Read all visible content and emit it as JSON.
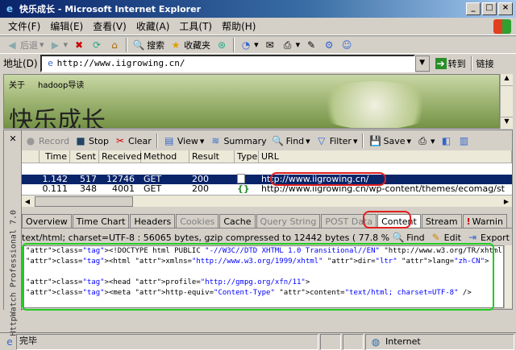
{
  "window": {
    "title": "快乐成长 - Microsoft Internet Explorer"
  },
  "menu": [
    "文件(F)",
    "编辑(E)",
    "查看(V)",
    "收藏(A)",
    "工具(T)",
    "帮助(H)"
  ],
  "toolbar": {
    "back": "后退",
    "search": "搜索",
    "favorites": "收藏夹"
  },
  "address": {
    "label": "地址(D)",
    "url": "http://www.iigrowing.cn/",
    "go": "转到",
    "links": "链接"
  },
  "page": {
    "nav": [
      "关于",
      "hadoop导读"
    ],
    "heading": "快乐成长"
  },
  "httpwatch": {
    "side_label": "HttpWatch Professional 7.0",
    "toolbar": {
      "record": "Record",
      "stop": "Stop",
      "clear": "Clear",
      "view": "View",
      "summary": "Summary",
      "find": "Find",
      "filter": "Filter",
      "save": "Save"
    },
    "columns": [
      "",
      "Time",
      "Sent",
      "Received",
      "Method",
      "Result",
      "Type",
      "URL"
    ],
    "rows": [
      {
        "time": "1.142",
        "sent": "517",
        "received": "12746",
        "method": "GET",
        "result": "200",
        "type": "page",
        "url": "http://www.iigrowing.cn/",
        "selected": true
      },
      {
        "time": "0.111",
        "sent": "348",
        "received": "4001",
        "method": "GET",
        "result": "200",
        "type": "{}",
        "url": "http://www.iigrowing.cn/wp-content/themes/ecomag/st",
        "selected": false
      }
    ],
    "tabs": [
      "Overview",
      "Time Chart",
      "Headers",
      "Cookies",
      "Cache",
      "Query String",
      "POST Data",
      "Content",
      "Stream",
      "Warnin"
    ],
    "tabs_dim": [
      false,
      false,
      false,
      true,
      false,
      true,
      true,
      false,
      false,
      false
    ],
    "active_tab": "Content",
    "info": "text/html; charset=UTF-8 : 56065 bytes, gzip compressed to 12442 bytes ( 77.8 % sav",
    "info_buttons": {
      "find": "Find",
      "edit": "Edit",
      "export": "Export"
    },
    "code_lines": [
      "<!DOCTYPE html PUBLIC \"-//W3C//DTD XHTML 1.0 Transitional//EN\" \"http://www.w3.org/TR/xhtml1/DTD/",
      "<html xmlns=\"http://www.w3.org/1999/xhtml\" dir=\"ltr\" lang=\"zh-CN\">",
      "",
      "<head profile=\"http://gmpg.org/xfn/11\">",
      "<meta http-equiv=\"Content-Type\" content=\"text/html; charset=UTF-8\" />"
    ]
  },
  "status": {
    "text": "完毕",
    "zone": "Internet"
  },
  "colors": {
    "highlight_red": "#e02020",
    "highlight_green": "#22cc22",
    "selection": "#0a246a"
  }
}
